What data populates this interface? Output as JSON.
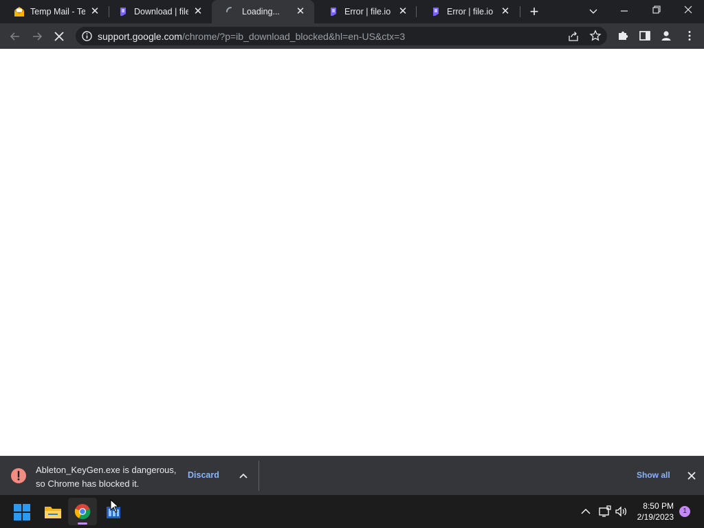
{
  "tabs": [
    {
      "title": "Temp Mail - Temp",
      "favicon": "envelope-icon",
      "active": false
    },
    {
      "title": "Download | file.io",
      "favicon": "file-io-icon",
      "active": false
    },
    {
      "title": "Loading...",
      "favicon": "spinner-icon",
      "active": true
    },
    {
      "title": "Error | file.io",
      "favicon": "file-io-icon",
      "active": false
    },
    {
      "title": "Error | file.io",
      "favicon": "file-io-icon",
      "active": false
    }
  ],
  "omnibox": {
    "host": "support.google.com",
    "path": "/chrome/?p=ib_download_blocked&hl=en-US&ctx=3"
  },
  "download_shelf": {
    "message": "Ableton_KeyGen.exe is dangerous, so Chrome has blocked it.",
    "discard_label": "Discard",
    "show_all_label": "Show all",
    "warning_color": "#f28b82"
  },
  "taskbar": {
    "time": "8:50 PM",
    "date": "2/19/2023",
    "notification_count": "1",
    "apps": [
      "windows-start-icon",
      "file-explorer-icon",
      "chrome-icon",
      "app-icon"
    ]
  },
  "colors": {
    "tabstrip_bg": "#202124",
    "toolbar_bg": "#35363a",
    "link_blue": "#8ab4f8"
  }
}
